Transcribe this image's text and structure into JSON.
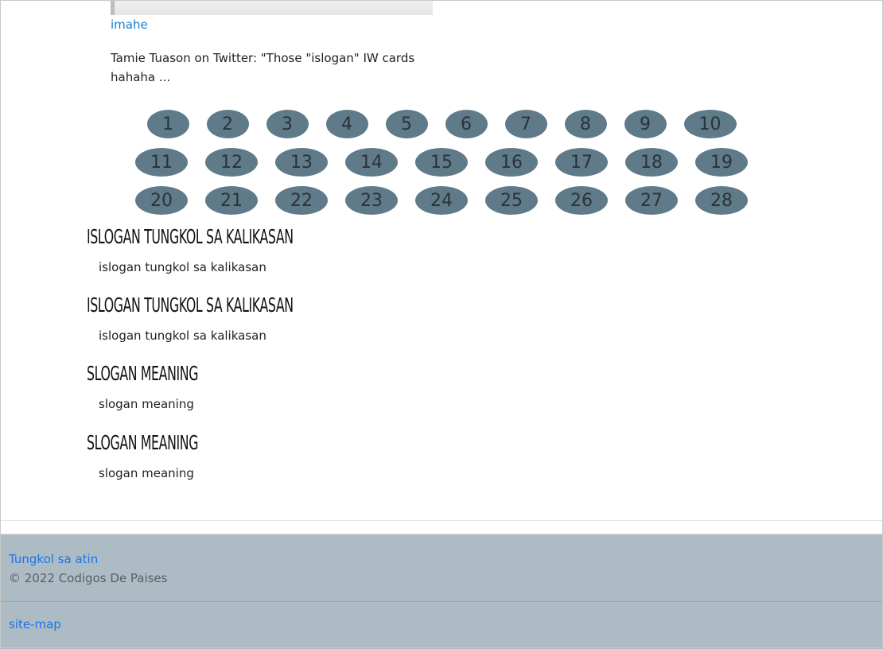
{
  "content": {
    "image_link": "imahe",
    "caption": "Tamie Tuason on Twitter: \"Those \"islogan\" IW cards hahaha ..."
  },
  "pagination": {
    "row1": [
      "1",
      "2",
      "3",
      "4",
      "5",
      "6",
      "7",
      "8",
      "9",
      "10"
    ],
    "row2": [
      "11",
      "12",
      "13",
      "14",
      "15",
      "16",
      "17",
      "18",
      "19"
    ],
    "row3": [
      "20",
      "21",
      "22",
      "23",
      "24",
      "25",
      "26",
      "27",
      "28"
    ]
  },
  "sections": [
    {
      "heading": "islogan tungkol sa kalikasan",
      "text": "islogan tungkol sa kalikasan"
    },
    {
      "heading": "islogan tungkol sa kalikasan",
      "text": "islogan tungkol sa kalikasan"
    },
    {
      "heading": "slogan meaning",
      "text": "slogan meaning"
    },
    {
      "heading": "slogan meaning",
      "text": "slogan meaning"
    }
  ],
  "footer": {
    "about_link": "Tungkol sa atin",
    "copyright": "© 2022 Codigos De Paises",
    "sitemap_link": "site-map"
  },
  "colors": {
    "page_button": "#5f7a89",
    "footer_bg": "#adbcc4",
    "link": "#1a73e8"
  }
}
